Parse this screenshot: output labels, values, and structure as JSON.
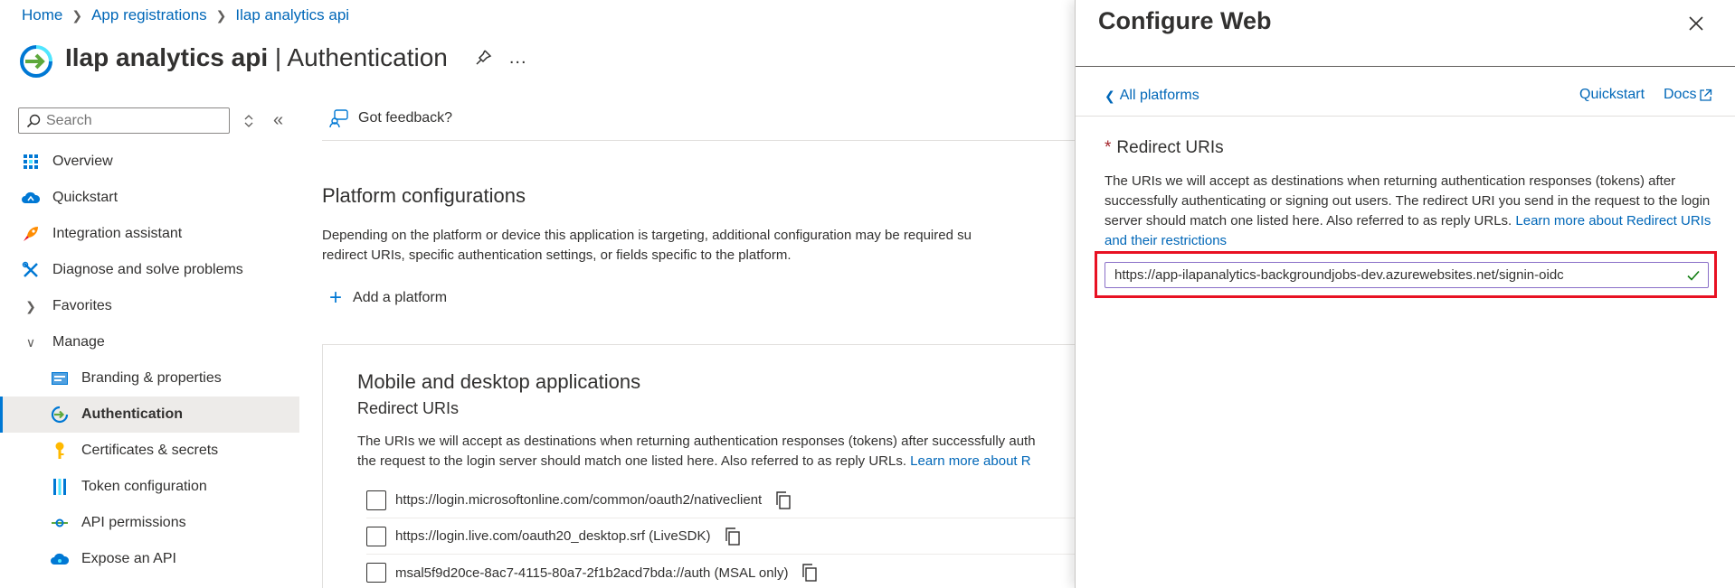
{
  "breadcrumb": {
    "home": "Home",
    "app_registrations": "App registrations",
    "current": "Ilap analytics api"
  },
  "header": {
    "app_name": "Ilap analytics api",
    "separator": "|",
    "section": "Authentication",
    "more": "..."
  },
  "sidebar": {
    "search_placeholder": "Search",
    "items": [
      {
        "label": "Overview",
        "icon": "grid-icon"
      },
      {
        "label": "Quickstart",
        "icon": "cloud-icon"
      },
      {
        "label": "Integration assistant",
        "icon": "rocket-icon"
      },
      {
        "label": "Diagnose and solve problems",
        "icon": "wrench-icon"
      },
      {
        "label": "Favorites",
        "icon": "chevron-right-icon"
      },
      {
        "label": "Manage",
        "icon": "chevron-down-icon"
      },
      {
        "label": "Branding & properties",
        "icon": "branding-icon"
      },
      {
        "label": "Authentication",
        "icon": "auth-icon"
      },
      {
        "label": "Certificates & secrets",
        "icon": "key-icon"
      },
      {
        "label": "Token configuration",
        "icon": "bars-icon"
      },
      {
        "label": "API permissions",
        "icon": "permissions-icon"
      },
      {
        "label": "Expose an API",
        "icon": "cloud-api-icon"
      }
    ]
  },
  "main": {
    "feedback": "Got feedback?",
    "platform_title": "Platform configurations",
    "platform_desc_1": "Depending on the platform or device this application is targeting, additional configuration may be required su",
    "platform_desc_2": "redirect URIs, specific authentication settings, or fields specific to the platform.",
    "add_platform": "Add a platform",
    "card": {
      "title": "Mobile and desktop applications",
      "subtitle": "Redirect URIs",
      "desc_1": "The URIs we will accept as destinations when returning authentication responses (tokens) after successfully auth",
      "desc_2": "the request to the login server should match one listed here. Also referred to as reply URLs.",
      "desc_link": "Learn more about R",
      "uris": [
        "https://login.microsoftonline.com/common/oauth2/nativeclient",
        "https://login.live.com/oauth20_desktop.srf (LiveSDK)",
        "msal5f9d20ce-8ac7-4115-80a7-2f1b2acd7bda://auth (MSAL only)"
      ]
    }
  },
  "panel": {
    "title": "Configure Web",
    "back": "All platforms",
    "quickstart": "Quickstart",
    "docs": "Docs",
    "required_mark": "*",
    "redirect_label": "Redirect URIs",
    "redirect_desc": "The URIs we will accept as destinations when returning authentication responses (tokens) after successfully authenticating or signing out users. The redirect URI you send in the request to the login server should match one listed here. Also referred to as reply URLs.",
    "redirect_link": "Learn more about Redirect URIs and their restrictions",
    "redirect_value": "https://app-ilapanalytics-backgroundjobs-dev.azurewebsites.net/signin-oidc"
  },
  "colors": {
    "accent": "#0078d4",
    "link": "#0067b8",
    "highlight": "#e81123",
    "valid": "#107c10"
  }
}
